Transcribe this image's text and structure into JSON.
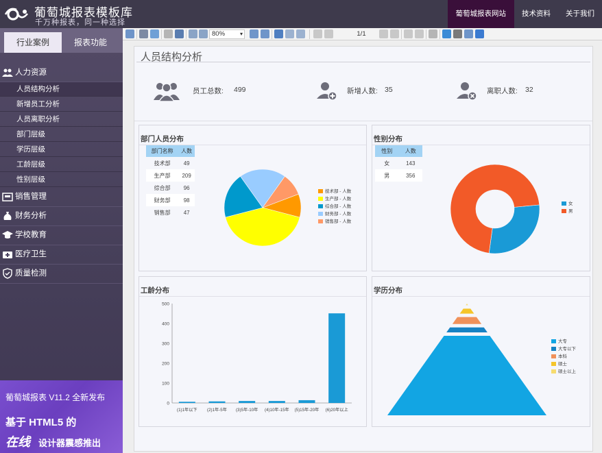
{
  "brand": {
    "title": "葡萄城报表模板库",
    "subtitle": "千万种报表，同一种选择"
  },
  "topnav": [
    {
      "label": "葡萄城报表网站",
      "active": true
    },
    {
      "label": "技术资料",
      "active": false
    },
    {
      "label": "关于我们",
      "active": false
    }
  ],
  "sidebar": {
    "tabs": [
      {
        "label": "行业案例",
        "active": true
      },
      {
        "label": "报表功能",
        "active": false
      }
    ],
    "groups": [
      {
        "label": "人力资源",
        "icon": "people-icon",
        "items": [
          {
            "label": "人员结构分析",
            "active": true
          },
          {
            "label": "新增员工分析",
            "active": false
          },
          {
            "label": "人员离职分析",
            "active": false
          },
          {
            "label": "部门层级",
            "active": false
          },
          {
            "label": "学历层级",
            "active": false
          },
          {
            "label": "工龄层级",
            "active": false
          },
          {
            "label": "性别层级",
            "active": false
          }
        ]
      },
      {
        "label": "销售管理",
        "icon": "store-icon"
      },
      {
        "label": "财务分析",
        "icon": "money-bag-icon"
      },
      {
        "label": "学校教育",
        "icon": "graduation-cap-icon"
      },
      {
        "label": "医疗卫生",
        "icon": "medical-kit-icon"
      },
      {
        "label": "质量检测",
        "icon": "quality-shield-icon"
      }
    ],
    "promo": {
      "line1": "葡萄城报表 V11.2 全新发布",
      "line2": "基于 HTML5 的",
      "line3": "在线",
      "line4": "设计器震感推出"
    }
  },
  "toolbar": {
    "zoom": "80%",
    "page": "1/1"
  },
  "report": {
    "title": "人员结构分析",
    "kpis": [
      {
        "label": "员工总数:",
        "value": "499",
        "icon": "group-users-icon"
      },
      {
        "label": "新增人数:",
        "value": "35",
        "icon": "add-user-icon"
      },
      {
        "label": "离职人数:",
        "value": "32",
        "icon": "remove-user-icon"
      }
    ],
    "dept_panel": {
      "title": "部门人员分布",
      "columns": [
        "部门名称",
        "人数"
      ],
      "rows": [
        [
          "技术部",
          "49"
        ],
        [
          "生产部",
          "209"
        ],
        [
          "综合部",
          "96"
        ],
        [
          "财务部",
          "98"
        ],
        [
          "销售部",
          "47"
        ]
      ]
    },
    "gender_panel": {
      "title": "性别分布",
      "columns": [
        "性别",
        "人数"
      ],
      "rows": [
        [
          "女",
          "143"
        ],
        [
          "男",
          "356"
        ]
      ]
    },
    "tenure_panel": {
      "title": "工龄分布"
    },
    "education_panel": {
      "title": "学历分布"
    }
  },
  "colors": {
    "topbar": "#3e3a4c",
    "active_nav": "#3a0f3a",
    "sidebar": "#4a4260",
    "table_header": "#a3d3f4"
  },
  "chart_data": [
    {
      "type": "pie",
      "title": "部门人员分布",
      "categories": [
        "技术部 - 人数",
        "生产部 - 人数",
        "综合部 - 人数",
        "财务部 - 人数",
        "销售部 - 人数"
      ],
      "values": [
        49,
        209,
        96,
        98,
        47
      ],
      "colors": [
        "#ff9900",
        "#ffff00",
        "#0099cc",
        "#99ccff",
        "#ff9966"
      ],
      "legend": "right"
    },
    {
      "type": "pie",
      "title": "性别分布",
      "donut": true,
      "categories": [
        "女",
        "男"
      ],
      "values": [
        143,
        356
      ],
      "colors": [
        "#1a9ad6",
        "#f25a28"
      ],
      "legend": "right"
    },
    {
      "type": "bar",
      "title": "工龄分布",
      "categories": [
        "(1)1年以下",
        "(2)1年-5年",
        "(3)5年-10年",
        "(4)10年-15年",
        "(5)15年-20年",
        "(6)20年以上"
      ],
      "values": [
        6,
        8,
        10,
        10,
        14,
        451
      ],
      "ylim": [
        0,
        500
      ],
      "yticks": [
        0,
        100,
        200,
        300,
        400,
        500
      ],
      "color": "#1a9ad6",
      "grid": false
    },
    {
      "type": "pyramid",
      "title": "学历分布",
      "categories": [
        "大专",
        "大专以下",
        "本科",
        "硕士",
        "硕士以上"
      ],
      "values": [
        400,
        25,
        35,
        25,
        8
      ],
      "colors": [
        "#12a5e3",
        "#1682c4",
        "#f0915a",
        "#f5c52a",
        "#f7dc6f"
      ],
      "legend": "right"
    }
  ]
}
